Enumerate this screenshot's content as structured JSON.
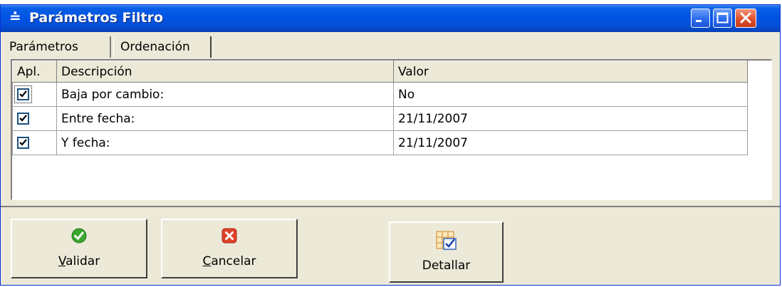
{
  "window": {
    "title": "Parámetros Filtro",
    "icon": "sort-icon"
  },
  "title_buttons": [
    "minimize",
    "maximize",
    "close"
  ],
  "tabs": [
    {
      "label": "Parámetros",
      "active": true
    },
    {
      "label": "Ordenación",
      "active": false
    }
  ],
  "grid": {
    "headers": {
      "apl": "Apl.",
      "descripcion": "Descripción",
      "valor": "Valor"
    },
    "rows": [
      {
        "checked": true,
        "descripcion": "Baja por cambio:",
        "valor": "No"
      },
      {
        "checked": true,
        "descripcion": "Entre fecha:",
        "valor": "21/11/2007"
      },
      {
        "checked": true,
        "descripcion": "Y fecha:",
        "valor": "21/11/2007"
      }
    ]
  },
  "buttons": {
    "validar": {
      "mnemonic": "V",
      "rest": "alidar",
      "icon": "check-icon"
    },
    "cancelar": {
      "mnemonic": "C",
      "rest": "ancelar",
      "icon": "cancel-icon"
    },
    "detallar": {
      "label": "Detallar",
      "icon": "grid-detail-icon"
    }
  },
  "colors": {
    "titlebar": "#0054e3",
    "window_bg": "#ece9d8",
    "close_button": "#e0502e",
    "check_green": "#3aa62e"
  }
}
